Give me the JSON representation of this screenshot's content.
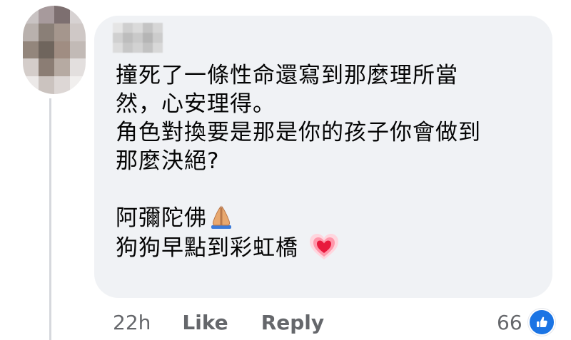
{
  "comment": {
    "lines": [
      "撞死了一條性命還寫到那麼理所當",
      "然，心安理得。",
      "角色對換要是那是你的孩子你會做到",
      "那麼決絕?",
      "",
      "阿彌陀佛",
      "狗狗早點到彩虹橋"
    ],
    "emoji_after_line_6": "folded-hands-icon",
    "emoji_after_line_7": "glowing-heart-icon"
  },
  "meta": {
    "time": "22h",
    "like_label": "Like",
    "reply_label": "Reply",
    "reaction_count": "66",
    "reaction_icon": "thumbs-up-icon"
  },
  "colors": {
    "bubble": "#f0f2f5",
    "text": "#050505",
    "secondary_text": "#65676b",
    "like_blue": "#1b74e4",
    "thread_line": "#d6d8dd"
  }
}
